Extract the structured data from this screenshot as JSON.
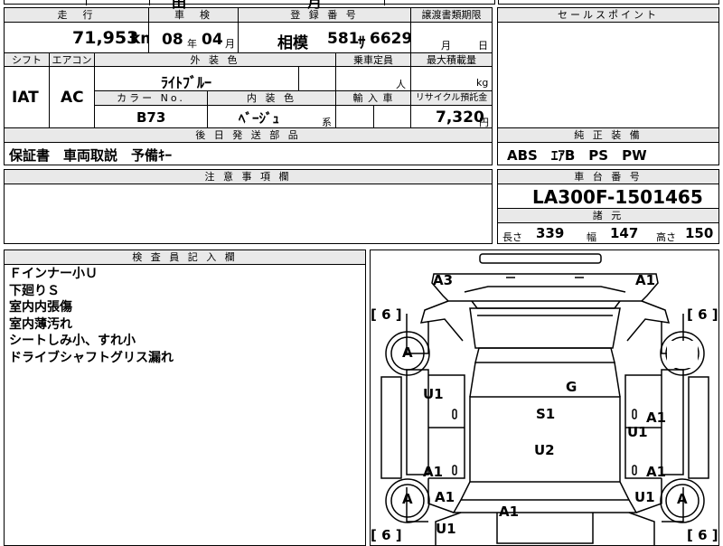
{
  "top_partial": {
    "text1": "田",
    "text2": "月"
  },
  "headers": {
    "mileage": "走　行",
    "inspection": "車　検",
    "registration": "登 録 番 号",
    "transfer_deadline": "譲渡書類期限",
    "sales_point": "セールスポイント",
    "shift": "シフト",
    "aircon": "エアコン",
    "exterior_color": "外 装 色",
    "capacity": "乗車定員",
    "max_load": "最大積載量",
    "color_no": "カラー No.",
    "interior_color": "内 装 色",
    "import": "輸 入 車",
    "recycle": "リサイクル預託金",
    "shipping_parts": "後 日 発 送 部 品",
    "equipment": "純 正 装 備",
    "caution": "注 意 事 項 欄",
    "chassis": "車 台 番 号",
    "specs": "諸 元",
    "inspector": "検 査 員 記 入 欄"
  },
  "values": {
    "mileage": "71,953",
    "mileage_unit": "km",
    "inspection_year": "08",
    "year_unit": "年",
    "inspection_month": "04",
    "month_unit": "月",
    "registration_place": "相模",
    "registration_class": "581",
    "registration_kana": "ｻ",
    "registration_number": "6629",
    "transfer_month_unit": "月",
    "transfer_day_unit": "日",
    "shift": "IAT",
    "aircon": "AC",
    "exterior_color": "ﾗｲﾄﾌﾞﾙｰ",
    "capacity_unit": "人",
    "load_unit": "kg",
    "color_no": "B73",
    "interior_color": "ﾍﾞｰｼﾞｭ",
    "interior_suffix": "系",
    "recycle_fee": "7,320",
    "recycle_unit": "円",
    "shipping_parts": "保証書　車両取説　予備ｷｰ",
    "equipment": "ABS　ｴｱB　PS　PW",
    "chassis_number": "LA300F-1501465",
    "length_label": "長さ",
    "length": "339",
    "width_label": "幅",
    "width": "147",
    "height_label": "高さ",
    "height": "150"
  },
  "inspector_notes": [
    "Ｆインナー小Ｕ",
    "下廻りＳ",
    "室内内張傷",
    "室内薄汚れ",
    "シートしみ小、すれ小",
    "ドライブシャフトグリス漏れ"
  ],
  "diagram": {
    "tire_left": "[ 6 ]",
    "tire_right": "[ 6 ]",
    "tire_bottom_left": "[ 6 ]",
    "tire_bottom_right": "[ 6 ]",
    "wheel_mark": "A",
    "marks": {
      "front_left": "A3",
      "front_right": "A1",
      "left_front_door": "U1",
      "roof": "G",
      "windshield_area": "S1",
      "right_front_door": "A1",
      "right_side": "U1",
      "center": "U2",
      "left_rear": "A1",
      "right_rear": "A1",
      "left_lower": "A1",
      "rear_center": "A1",
      "right_lower": "U1",
      "left_bottom": "U1"
    }
  }
}
